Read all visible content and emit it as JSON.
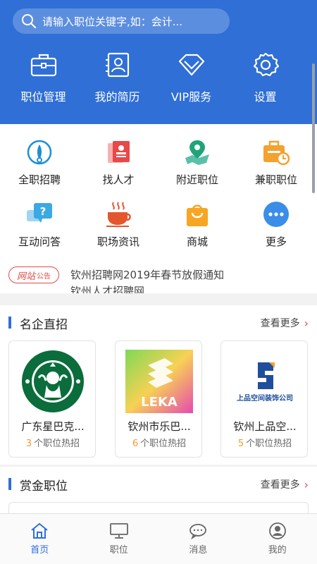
{
  "search": {
    "placeholder": "请输入职位关键字,如：会计..."
  },
  "top_menu": [
    {
      "label": "职位管理",
      "icon": "briefcase-icon"
    },
    {
      "label": "我的简历",
      "icon": "resume-icon"
    },
    {
      "label": "VIP服务",
      "icon": "diamond-icon"
    },
    {
      "label": "设置",
      "icon": "gear-icon"
    }
  ],
  "grid": [
    {
      "label": "全职招聘",
      "icon": "fulltime-icon"
    },
    {
      "label": "找人才",
      "icon": "find-talent-icon"
    },
    {
      "label": "附近职位",
      "icon": "location-icon"
    },
    {
      "label": "兼职职位",
      "icon": "parttime-icon"
    },
    {
      "label": "互动问答",
      "icon": "qa-icon"
    },
    {
      "label": "职场资讯",
      "icon": "coffee-icon"
    },
    {
      "label": "商城",
      "icon": "shopping-bag-icon"
    },
    {
      "label": "更多",
      "icon": "more-icon"
    }
  ],
  "notice": {
    "badge_main": "网站",
    "badge_sub": "公告",
    "line1": "钦州招聘网2019年春节放假通知",
    "line2": "钦州人才招聘网..."
  },
  "famous": {
    "title": "名企直招",
    "more": "查看更多",
    "companies": [
      {
        "name": "广东星巴克...",
        "count": "3",
        "suffix": "个职位热招"
      },
      {
        "name": "钦州市乐巴...",
        "count": "6",
        "suffix": "个职位热招"
      },
      {
        "name": "钦州上品空...",
        "count": "5",
        "suffix": "个职位热招"
      }
    ],
    "logo_texts": {
      "leka": "LEKA",
      "shangpin": "上品空间装饰公司"
    }
  },
  "reward": {
    "title": "赏金职位",
    "more": "查看更多"
  },
  "bottom_nav": [
    {
      "label": "首页",
      "icon": "home-icon",
      "active": true
    },
    {
      "label": "职位",
      "icon": "monitor-icon",
      "active": false
    },
    {
      "label": "消息",
      "icon": "message-icon",
      "active": false
    },
    {
      "label": "我的",
      "icon": "user-icon",
      "active": false
    }
  ],
  "colors": {
    "primary": "#2f6fd6",
    "accent_red": "#e24b4b",
    "accent_orange": "#f39a2b"
  }
}
